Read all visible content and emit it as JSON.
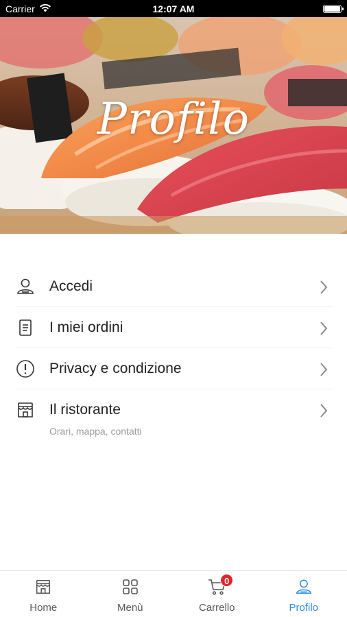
{
  "status_bar": {
    "carrier": "Carrier",
    "time": "12:07 AM"
  },
  "hero": {
    "title": "Profilo"
  },
  "menu": {
    "items": [
      {
        "label": "Accedi",
        "icon": "person-icon"
      },
      {
        "label": "I miei ordini",
        "icon": "document-icon"
      },
      {
        "label": "Privacy e condizione",
        "icon": "alert-circle-icon"
      },
      {
        "label": "Il ristorante",
        "icon": "store-icon",
        "subtitle": "Orari, mappa, contatti"
      }
    ]
  },
  "tab_bar": {
    "tabs": [
      {
        "label": "Home",
        "icon": "store-icon"
      },
      {
        "label": "Menù",
        "icon": "grid-icon"
      },
      {
        "label": "Carrello",
        "icon": "cart-icon",
        "badge": "0"
      },
      {
        "label": "Profilo",
        "icon": "person-icon",
        "active": true
      }
    ],
    "active_color": "#2f8ae6",
    "badge_color": "#e0252d"
  }
}
